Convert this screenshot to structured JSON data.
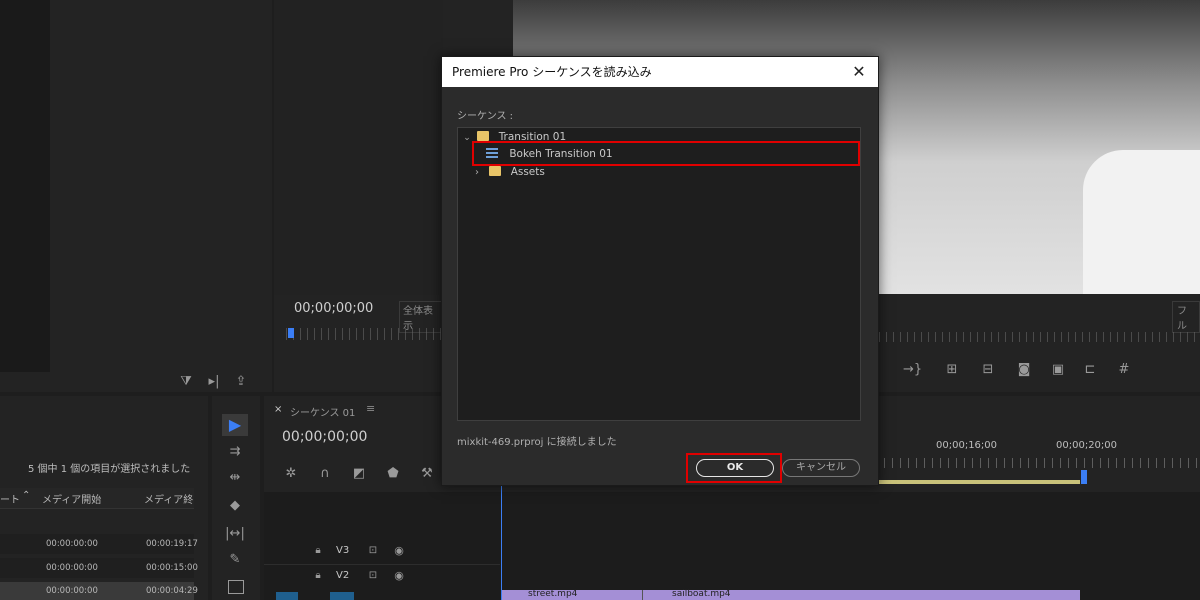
{
  "source_panel": {
    "timecode": "00;00;00;00",
    "fit_label": "全体表示",
    "icons": [
      "funnel-icon",
      "step-forward-icon",
      "export-icon"
    ]
  },
  "program_panel": {
    "fit_label": "フル"
  },
  "project_panel": {
    "selection_status": "5 個中 1 個の項目が選択されました",
    "columns": [
      "ート",
      "メディア開始",
      "メディア終"
    ],
    "rows": [
      {
        "start": "00:00:00:00",
        "end": "00:00:19:17"
      },
      {
        "start": "00:00:00:00",
        "end": "00:00:15:00"
      },
      {
        "start": "00:00:00:00",
        "end": "00:00:04:29"
      }
    ]
  },
  "timeline": {
    "tab_label": "シーケンス 01",
    "timecode": "00;00;00;00",
    "ruler_labels": [
      "00;00;16;00",
      "00;00;20;00"
    ],
    "tracks": [
      {
        "name": "V3"
      },
      {
        "name": "V2"
      }
    ],
    "clips": [
      "street.mp4",
      "sailboat.mp4"
    ]
  },
  "dialog": {
    "title": "Premiere Pro シーケンスを読み込み",
    "section_label": "シーケンス :",
    "tree": {
      "root": "Transition 01",
      "sequence": "Bokeh Transition 01",
      "folder": "Assets"
    },
    "status": "mixkit-469.prproj に接続しました",
    "ok_label": "OK",
    "cancel_label": "キャンセル"
  },
  "colors": {
    "highlight": "#e00000",
    "clip_purple": "#a48fd6",
    "playhead_blue": "#3b7ef5"
  }
}
